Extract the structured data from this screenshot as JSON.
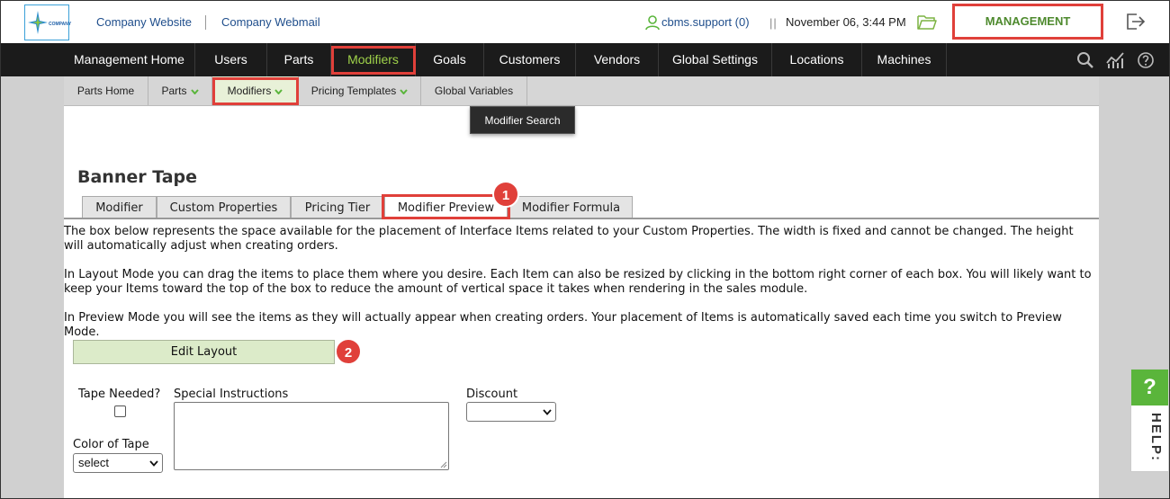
{
  "top": {
    "logo_text": "COMPANY",
    "company_website": "Company Website",
    "company_webmail": "Company Webmail",
    "user": "cbms.support (0)",
    "separator": "||",
    "datetime": "November 06, 3:44 PM",
    "management": "MANAGEMENT"
  },
  "nav": {
    "items": [
      "Management Home",
      "Users",
      "Parts",
      "Modifiers",
      "Goals",
      "Customers",
      "Vendors",
      "Global Settings",
      "Locations",
      "Machines"
    ],
    "active": "Modifiers"
  },
  "subnav": {
    "items": [
      "Parts Home",
      "Parts",
      "Modifiers",
      "Pricing Templates",
      "Global Variables"
    ],
    "active": "Modifiers",
    "dropdown_item": "Modifier Search"
  },
  "page": {
    "title": "Banner Tape",
    "tabs": [
      "Modifier",
      "Custom Properties",
      "Pricing Tier",
      "Modifier Preview",
      "Modifier Formula"
    ],
    "active_tab": "Modifier Preview",
    "paragraphs": [
      "The box below represents the space available for the placement of Interface Items related to your Custom Properties. The width is fixed and cannot be changed. The height will automatically adjust when creating orders.",
      "In Layout Mode you can drag the items to place them where you desire. Each Item can also be resized by clicking in the bottom right corner of each box. You will likely want to keep your Items toward the top of the box to reduce the amount of vertical space it takes when rendering in the sales module.",
      "In Preview Mode you will see the items as they will actually appear when creating orders. Your placement of Items is automatically saved each time you switch to Preview Mode."
    ],
    "edit_layout": "Edit Layout"
  },
  "form": {
    "tape_needed_label": "Tape Needed?",
    "tape_needed_checked": false,
    "special_instructions_label": "Special Instructions",
    "special_instructions_value": "",
    "discount_label": "Discount",
    "discount_value": "",
    "color_of_tape_label": "Color of Tape",
    "color_of_tape_value": "select"
  },
  "annotations": {
    "badge_1": "1",
    "badge_2": "2"
  },
  "help": {
    "icon": "?",
    "label": "HELP:"
  },
  "colors": {
    "accent_green": "#9fd24a",
    "nav_bg": "#1b1b1b",
    "highlight_red": "#e0403a",
    "management_green": "#4e8a2e",
    "button_green": "#dcebc9"
  }
}
